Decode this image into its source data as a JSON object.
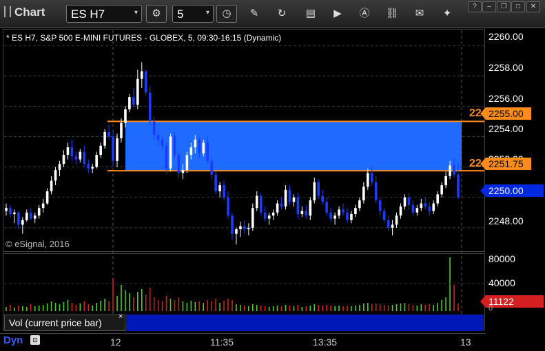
{
  "toolbar": {
    "app_title": "Chart",
    "symbol": "ES H7",
    "interval": "5",
    "symbol_dropdown": "▾",
    "interval_dropdown": "▾"
  },
  "chart": {
    "title": "* ES H7, S&P 500 E-MINI FUTURES - GLOBEX, 5, 09:30-16:15 (Dynamic)",
    "copyright": "© eSignal, 2016",
    "volume_label": "Vol (current price bar)",
    "volume_close": "×",
    "dyn_label": "Dyn",
    "price_ticks": [
      "2260.00",
      "2258.00",
      "2256.00",
      "2254.00",
      "2252.00",
      "2250.00",
      "2248.00"
    ],
    "volume_ticks": [
      "80000",
      "40000",
      "0"
    ],
    "time_labels": [
      "12",
      "11:35",
      "13:35",
      "13"
    ],
    "upper_line_price_tag": "2255.00",
    "lower_line_price_tag": "2251.75",
    "current_price_tag": "2250.00",
    "current_volume_tag": "11122",
    "upper_line_label": "22",
    "lower_line_label": "22",
    "colors": {
      "up_candle": "#ffffff",
      "down_candle": "#1a3cff",
      "zone_fill": "#1f6bff",
      "horizontal_line": "#ff8c1a",
      "volume_up": "#4ccf2a",
      "volume_down": "#d42020"
    }
  },
  "chart_data": {
    "type": "candlestick",
    "title": "* ES H7, S&P 500 E-MINI FUTURES - GLOBEX, 5, 09:30-16:15 (Dynamic)",
    "ylim": [
      2246.5,
      2261
    ],
    "y_ticks": [
      2248,
      2250,
      2252,
      2254,
      2256,
      2258,
      2260
    ],
    "x_labels": [
      "12",
      "11:35",
      "13:35",
      "13"
    ],
    "zone": {
      "upper": 2255.0,
      "lower": 2251.75
    },
    "last_price": 2250.0,
    "volume_ylim": [
      0,
      80000
    ],
    "last_volume": 11122,
    "candles": [
      [
        2249.1,
        2249.6,
        2248.8,
        2249.3
      ],
      [
        2249.3,
        2249.5,
        2248.7,
        2248.9
      ],
      [
        2248.9,
        2249.2,
        2248.3,
        2249.0
      ],
      [
        2249.0,
        2249.1,
        2247.9,
        2248.2
      ],
      [
        2248.2,
        2248.7,
        2247.6,
        2248.5
      ],
      [
        2248.5,
        2249.2,
        2248.4,
        2249.0
      ],
      [
        2249.0,
        2249.3,
        2248.5,
        2248.6
      ],
      [
        2248.6,
        2249.0,
        2248.3,
        2248.8
      ],
      [
        2248.8,
        2249.5,
        2248.6,
        2249.3
      ],
      [
        2249.3,
        2249.9,
        2249.0,
        2249.6
      ],
      [
        2249.6,
        2250.6,
        2249.5,
        2250.4
      ],
      [
        2250.4,
        2251.4,
        2250.2,
        2251.1
      ],
      [
        2251.1,
        2252.0,
        2250.8,
        2251.8
      ],
      [
        2251.8,
        2252.4,
        2251.4,
        2252.2
      ],
      [
        2252.2,
        2253.1,
        2252.0,
        2252.8
      ],
      [
        2252.8,
        2253.6,
        2252.5,
        2253.3
      ],
      [
        2253.3,
        2253.8,
        2252.4,
        2252.7
      ],
      [
        2252.7,
        2253.0,
        2252.2,
        2252.5
      ],
      [
        2252.5,
        2253.2,
        2252.3,
        2253.0
      ],
      [
        2253.0,
        2253.4,
        2252.0,
        2252.2
      ],
      [
        2252.2,
        2252.5,
        2251.6,
        2251.9
      ],
      [
        2251.9,
        2252.2,
        2251.6,
        2252.0
      ],
      [
        2252.0,
        2253.0,
        2251.9,
        2252.8
      ],
      [
        2252.8,
        2253.6,
        2252.6,
        2253.4
      ],
      [
        2253.4,
        2254.5,
        2253.2,
        2254.3
      ],
      [
        2254.3,
        2254.8,
        2253.8,
        2254.0
      ],
      [
        2254.0,
        2254.4,
        2252.0,
        2252.4
      ],
      [
        2252.4,
        2254.2,
        2252.0,
        2253.9
      ],
      [
        2253.9,
        2255.2,
        2253.6,
        2254.9
      ],
      [
        2254.9,
        2256.0,
        2254.6,
        2255.8
      ],
      [
        2255.8,
        2256.8,
        2255.6,
        2256.6
      ],
      [
        2256.6,
        2257.2,
        2255.9,
        2256.1
      ],
      [
        2256.1,
        2258.4,
        2255.8,
        2257.8
      ],
      [
        2257.8,
        2258.9,
        2257.2,
        2258.3
      ],
      [
        2258.3,
        2258.4,
        2256.7,
        2256.9
      ],
      [
        2256.9,
        2257.3,
        2254.8,
        2255.0
      ],
      [
        2255.0,
        2255.3,
        2253.8,
        2254.1
      ],
      [
        2254.1,
        2254.5,
        2253.4,
        2253.8
      ],
      [
        2253.8,
        2254.0,
        2253.1,
        2253.4
      ],
      [
        2253.4,
        2253.6,
        2251.6,
        2251.9
      ],
      [
        2251.9,
        2254.2,
        2251.7,
        2254.0
      ],
      [
        2254.0,
        2254.3,
        2252.6,
        2252.8
      ],
      [
        2252.8,
        2253.1,
        2251.3,
        2251.6
      ],
      [
        2251.6,
        2252.2,
        2251.2,
        2251.8
      ],
      [
        2251.8,
        2253.0,
        2251.6,
        2252.8
      ],
      [
        2252.8,
        2253.6,
        2252.5,
        2253.3
      ],
      [
        2253.3,
        2254.1,
        2252.9,
        2253.8
      ],
      [
        2253.8,
        2254.0,
        2252.6,
        2252.9
      ],
      [
        2252.9,
        2253.8,
        2252.7,
        2253.6
      ],
      [
        2253.6,
        2254.0,
        2252.2,
        2252.4
      ],
      [
        2252.4,
        2252.6,
        2251.2,
        2251.5
      ],
      [
        2251.5,
        2251.7,
        2250.2,
        2250.4
      ],
      [
        2250.4,
        2251.0,
        2250.0,
        2250.8
      ],
      [
        2250.8,
        2251.1,
        2249.8,
        2250.0
      ],
      [
        2250.0,
        2250.4,
        2248.6,
        2248.8
      ],
      [
        2248.8,
        2249.0,
        2247.2,
        2247.6
      ],
      [
        2247.6,
        2248.0,
        2246.9,
        2247.9
      ],
      [
        2247.9,
        2248.4,
        2247.4,
        2248.1
      ],
      [
        2248.1,
        2248.5,
        2247.6,
        2247.9
      ],
      [
        2247.9,
        2248.3,
        2247.5,
        2248.0
      ],
      [
        2248.0,
        2249.6,
        2247.8,
        2249.3
      ],
      [
        2249.3,
        2250.4,
        2249.1,
        2250.1
      ],
      [
        2250.1,
        2250.3,
        2248.8,
        2249.0
      ],
      [
        2249.0,
        2249.4,
        2248.4,
        2248.6
      ],
      [
        2248.6,
        2249.0,
        2248.2,
        2248.8
      ],
      [
        2248.8,
        2249.2,
        2248.5,
        2249.0
      ],
      [
        2249.0,
        2249.8,
        2248.8,
        2249.6
      ],
      [
        2249.6,
        2250.0,
        2249.2,
        2249.4
      ],
      [
        2249.4,
        2250.8,
        2249.2,
        2250.5
      ],
      [
        2250.5,
        2250.8,
        2249.5,
        2249.7
      ],
      [
        2249.7,
        2250.2,
        2249.4,
        2250.0
      ],
      [
        2250.0,
        2250.3,
        2248.6,
        2248.9
      ],
      [
        2248.9,
        2249.4,
        2248.7,
        2249.1
      ],
      [
        2249.1,
        2249.5,
        2248.6,
        2248.8
      ],
      [
        2248.8,
        2250.0,
        2248.5,
        2249.8
      ],
      [
        2249.8,
        2251.3,
        2249.6,
        2251.0
      ],
      [
        2251.0,
        2251.2,
        2249.9,
        2250.1
      ],
      [
        2250.1,
        2250.5,
        2249.5,
        2249.7
      ],
      [
        2249.7,
        2250.0,
        2248.8,
        2249.0
      ],
      [
        2249.0,
        2249.3,
        2248.4,
        2248.6
      ],
      [
        2248.6,
        2249.0,
        2248.2,
        2248.8
      ],
      [
        2248.8,
        2249.4,
        2248.6,
        2249.2
      ],
      [
        2249.2,
        2249.6,
        2248.8,
        2249.0
      ],
      [
        2249.0,
        2249.3,
        2248.3,
        2248.5
      ],
      [
        2248.5,
        2249.1,
        2248.3,
        2248.9
      ],
      [
        2248.9,
        2249.5,
        2248.7,
        2249.3
      ],
      [
        2249.3,
        2250.0,
        2249.1,
        2249.8
      ],
      [
        2249.8,
        2251.0,
        2249.6,
        2250.7
      ],
      [
        2250.7,
        2251.9,
        2250.5,
        2251.6
      ],
      [
        2251.6,
        2252.0,
        2250.8,
        2251.0
      ],
      [
        2251.0,
        2251.4,
        2249.6,
        2249.8
      ],
      [
        2249.8,
        2250.0,
        2248.8,
        2249.1
      ],
      [
        2249.1,
        2249.3,
        2248.3,
        2248.5
      ],
      [
        2248.5,
        2248.8,
        2247.8,
        2248.0
      ],
      [
        2248.0,
        2248.5,
        2247.5,
        2248.2
      ],
      [
        2248.2,
        2249.0,
        2248.0,
        2248.8
      ],
      [
        2248.8,
        2249.6,
        2248.6,
        2249.4
      ],
      [
        2249.4,
        2250.2,
        2249.2,
        2250.0
      ],
      [
        2250.0,
        2250.3,
        2249.2,
        2249.5
      ],
      [
        2249.5,
        2249.8,
        2248.8,
        2249.0
      ],
      [
        2249.0,
        2249.5,
        2248.8,
        2249.3
      ],
      [
        2249.3,
        2249.9,
        2249.1,
        2249.6
      ],
      [
        2249.6,
        2250.0,
        2249.2,
        2249.4
      ],
      [
        2249.4,
        2249.7,
        2248.8,
        2249.1
      ],
      [
        2249.1,
        2249.8,
        2248.9,
        2249.6
      ],
      [
        2249.6,
        2250.4,
        2249.4,
        2250.2
      ],
      [
        2250.2,
        2251.0,
        2250.0,
        2250.8
      ],
      [
        2250.8,
        2251.7,
        2250.6,
        2251.4
      ],
      [
        2251.4,
        2252.4,
        2251.2,
        2252.1
      ],
      [
        2252.1,
        2252.6,
        2251.3,
        2251.5
      ],
      [
        2251.5,
        2252.3,
        2249.9,
        2250.0
      ]
    ],
    "volumes": [
      [
        6000,
        1
      ],
      [
        9000,
        0
      ],
      [
        5000,
        1
      ],
      [
        8000,
        0
      ],
      [
        7000,
        1
      ],
      [
        6000,
        1
      ],
      [
        10000,
        0
      ],
      [
        7000,
        1
      ],
      [
        8000,
        1
      ],
      [
        9000,
        1
      ],
      [
        11000,
        1
      ],
      [
        14000,
        1
      ],
      [
        12000,
        1
      ],
      [
        10000,
        1
      ],
      [
        13000,
        1
      ],
      [
        16000,
        1
      ],
      [
        12000,
        0
      ],
      [
        9000,
        0
      ],
      [
        11000,
        1
      ],
      [
        14000,
        0
      ],
      [
        10000,
        0
      ],
      [
        8000,
        1
      ],
      [
        12000,
        1
      ],
      [
        15000,
        1
      ],
      [
        18000,
        1
      ],
      [
        14000,
        0
      ],
      [
        48000,
        0
      ],
      [
        22000,
        1
      ],
      [
        38000,
        1
      ],
      [
        30000,
        1
      ],
      [
        26000,
        1
      ],
      [
        20000,
        0
      ],
      [
        28000,
        1
      ],
      [
        32000,
        1
      ],
      [
        24000,
        0
      ],
      [
        34000,
        0
      ],
      [
        20000,
        0
      ],
      [
        16000,
        0
      ],
      [
        14000,
        0
      ],
      [
        22000,
        0
      ],
      [
        18000,
        1
      ],
      [
        16000,
        0
      ],
      [
        20000,
        0
      ],
      [
        14000,
        1
      ],
      [
        12000,
        1
      ],
      [
        15000,
        1
      ],
      [
        13000,
        1
      ],
      [
        14000,
        0
      ],
      [
        12000,
        1
      ],
      [
        16000,
        0
      ],
      [
        14000,
        0
      ],
      [
        18000,
        0
      ],
      [
        12000,
        1
      ],
      [
        15000,
        0
      ],
      [
        18000,
        0
      ],
      [
        16000,
        0
      ],
      [
        10000,
        1
      ],
      [
        9000,
        1
      ],
      [
        8000,
        0
      ],
      [
        7000,
        1
      ],
      [
        10000,
        1
      ],
      [
        9000,
        1
      ],
      [
        8000,
        0
      ],
      [
        7000,
        0
      ],
      [
        6000,
        1
      ],
      [
        7000,
        1
      ],
      [
        8000,
        1
      ],
      [
        7000,
        0
      ],
      [
        9000,
        1
      ],
      [
        8000,
        0
      ],
      [
        7000,
        1
      ],
      [
        9000,
        0
      ],
      [
        6000,
        1
      ],
      [
        7000,
        0
      ],
      [
        8000,
        1
      ],
      [
        10000,
        1
      ],
      [
        9000,
        0
      ],
      [
        8000,
        0
      ],
      [
        9000,
        0
      ],
      [
        8000,
        0
      ],
      [
        7000,
        1
      ],
      [
        8000,
        1
      ],
      [
        7000,
        0
      ],
      [
        8000,
        0
      ],
      [
        7000,
        1
      ],
      [
        8000,
        1
      ],
      [
        9000,
        1
      ],
      [
        11000,
        1
      ],
      [
        12000,
        1
      ],
      [
        10000,
        0
      ],
      [
        11000,
        0
      ],
      [
        10000,
        0
      ],
      [
        9000,
        0
      ],
      [
        8000,
        0
      ],
      [
        9000,
        1
      ],
      [
        10000,
        1
      ],
      [
        11000,
        1
      ],
      [
        12000,
        1
      ],
      [
        10000,
        0
      ],
      [
        9000,
        0
      ],
      [
        8000,
        1
      ],
      [
        10000,
        1
      ],
      [
        9000,
        0
      ],
      [
        10000,
        0
      ],
      [
        9000,
        1
      ],
      [
        12000,
        1
      ],
      [
        16000,
        1
      ],
      [
        20000,
        1
      ],
      [
        78000,
        1
      ],
      [
        38000,
        0
      ],
      [
        11122,
        0
      ]
    ]
  }
}
